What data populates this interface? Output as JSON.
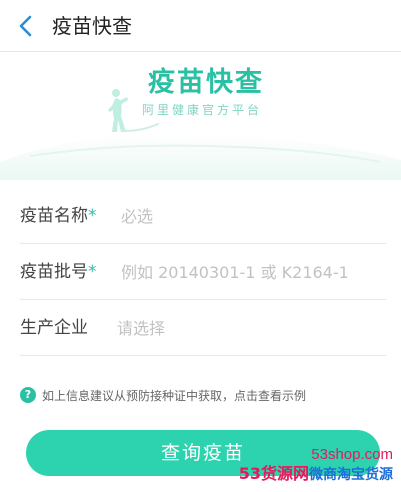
{
  "header": {
    "title": "疫苗快查",
    "back_icon": "chevron-left-icon"
  },
  "banner": {
    "title": "疫苗快查",
    "subtitle": "阿里健康官方平台"
  },
  "form": {
    "fields": [
      {
        "label": "疫苗名称",
        "required_mark": "*",
        "placeholder": "必选",
        "value": ""
      },
      {
        "label": "疫苗批号",
        "required_mark": "*",
        "placeholder": "例如 20140301-1 或 K2164-1",
        "value": ""
      },
      {
        "label": "生产企业",
        "required_mark": "",
        "placeholder": "请选择",
        "value": ""
      }
    ]
  },
  "hint": {
    "icon": "question-circle-icon",
    "text": "如上信息建议从预防接种证中获取，点击查看示例"
  },
  "submit": {
    "label": "查询疫苗"
  },
  "watermark": {
    "domain": "53shop.com",
    "brand_red": "53货源网",
    "brand_blue": "微商淘宝货源"
  },
  "colors": {
    "accent": "#2ac0a4",
    "button": "#2dd2ae",
    "back_icon": "#2b8cd8",
    "watermark_red": "#e8185c",
    "watermark_blue": "#1c6fd8"
  }
}
